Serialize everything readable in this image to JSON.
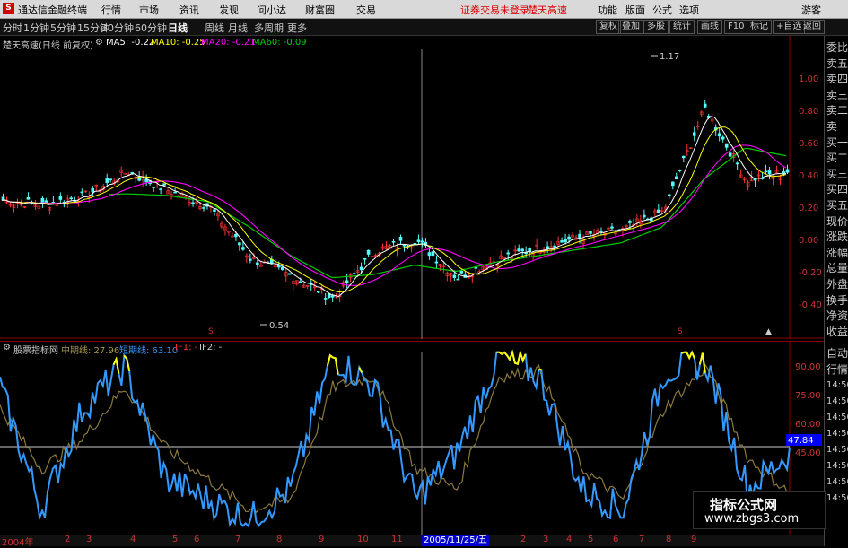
{
  "app": {
    "title": "通达信金融终端",
    "logo_text": "S"
  },
  "topmenu": [
    "行情",
    "市场",
    "资讯",
    "发现",
    "问小达",
    "财富圈",
    "交易"
  ],
  "notice": {
    "login": "证券交易未登录",
    "speed": "楚天高速"
  },
  "topright": [
    "功能",
    "版面",
    "公式",
    "选项",
    "游客"
  ],
  "periods": [
    "分时",
    "1分钟",
    "5分钟",
    "15分钟",
    "30分钟",
    "60分钟",
    "日线",
    "周线",
    "月线",
    "多周期",
    "更多"
  ],
  "active_period": "日线",
  "right_buttons": [
    "复权",
    "叠加",
    "多股",
    "统计",
    "画线",
    "F10",
    "标记",
    "+自选",
    "返回"
  ],
  "main": {
    "title": "楚天高速(日线 前复权)",
    "ma5": "MA5: -0.22",
    "ma10": "MA10: -0.25",
    "ma20": "MA20: -0.21",
    "ma60": "MA60: -0.09",
    "high_label": "1.17",
    "low_label": "0.54",
    "yaxis": [
      "1.00",
      "0.80",
      "0.60",
      "0.40",
      "0.20",
      "0.00",
      "-0.20",
      "-0.40"
    ]
  },
  "sub": {
    "title": "股票指标网",
    "mid_label": "中期线: 27.96",
    "short_label": "短期线: 63.10",
    "if1": "IF1: -",
    "if2": "IF2: -",
    "yaxis": [
      "90.00",
      "75.00",
      "60.00",
      "45.00"
    ],
    "current": "47.84"
  },
  "xaxis": {
    "labels": [
      "2004年",
      "2",
      "3",
      "4",
      "5",
      "6",
      "7",
      "8",
      "9",
      "10",
      "11",
      "2",
      "3",
      "4",
      "5",
      "6",
      "7",
      "8",
      "9"
    ],
    "cursor_date": "2005/11/25/五"
  },
  "right_panel": {
    "top": [
      "委比",
      "卖五",
      "卖四",
      "卖三",
      "卖二",
      "卖一",
      "买一",
      "买二",
      "买三",
      "买四",
      "买五",
      "现价",
      "涨跌",
      "涨幅",
      "总量",
      "外盘",
      "换手",
      "净资",
      "收益"
    ],
    "bottom": [
      "自动",
      "行情",
      "14:50",
      "14:50",
      "14:50",
      "14:50",
      "14:50",
      "14:50",
      "14:50",
      "14:50"
    ]
  },
  "watermark": {
    "line1": "指标公式网",
    "line2": "www.zbgs3.com"
  },
  "colors": {
    "up": "#ff3333",
    "down": "#54fcfc",
    "ma5": "#ffffff",
    "ma10": "#ffff00",
    "ma20": "#ff00ff",
    "ma60": "#00cc00",
    "short": "#3399ff",
    "mid": "#8a7a40",
    "hot": "#ffff00"
  },
  "chart_data": [
    {
      "type": "line",
      "title": "楚天高速(日线 前复权)",
      "x": [
        "2004年",
        "2",
        "3",
        "4",
        "5",
        "6",
        "7",
        "8",
        "9",
        "10",
        "11",
        "2005/11/25",
        "2",
        "3",
        "4",
        "5",
        "6",
        "7",
        "8",
        "9"
      ],
      "series": [
        {
          "name": "MA5",
          "values": [
            0.27,
            0.24,
            0.3,
            0.45,
            0.33,
            0.23,
            -0.1,
            -0.21,
            -0.35,
            -0.05,
            0.02,
            -0.22,
            -0.1,
            -0.03,
            0.04,
            0.08,
            0.2,
            0.85,
            0.4,
            0.45
          ]
        },
        {
          "name": "MA60",
          "values": [
            0.25,
            0.28,
            0.3,
            0.31,
            0.3,
            0.26,
            0.1,
            -0.08,
            -0.22,
            -0.2,
            -0.14,
            -0.18,
            -0.12,
            -0.08,
            -0.04,
            0.0,
            0.1,
            0.4,
            0.6,
            0.55
          ]
        }
      ],
      "ylim": [
        -0.55,
        1.25
      ],
      "annotations": [
        "1.17",
        "0.54"
      ]
    },
    {
      "type": "line",
      "title": "股票指标网",
      "series": [
        {
          "name": "短期线",
          "values": [
            80,
            20,
            70,
            90,
            35,
            25,
            15,
            30,
            95,
            80,
            25,
            48,
            95,
            85,
            30,
            20,
            88,
            92,
            30,
            47.84
          ]
        },
        {
          "name": "中期线",
          "values": [
            70,
            40,
            55,
            80,
            50,
            35,
            20,
            25,
            80,
            85,
            40,
            30,
            85,
            88,
            40,
            25,
            70,
            90,
            45,
            27.96
          ]
        }
      ],
      "ylim": [
        10,
        100
      ]
    }
  ]
}
